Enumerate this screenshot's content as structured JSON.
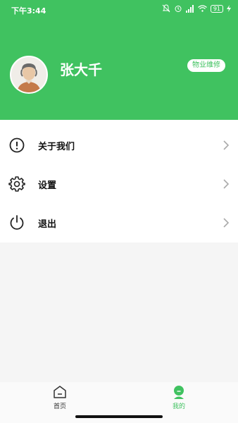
{
  "status_bar": {
    "time": "下午3:44",
    "battery": "91",
    "icons": [
      "mute-icon",
      "alarm-icon",
      "signal-icon",
      "wifi-icon",
      "battery-icon",
      "charging-icon"
    ]
  },
  "profile": {
    "name": "张大千",
    "role_badge": "物业维修"
  },
  "menu": {
    "items": [
      {
        "label": "关于我们",
        "icon": "info-icon"
      },
      {
        "label": "设置",
        "icon": "gear-icon"
      },
      {
        "label": "退出",
        "icon": "power-icon"
      }
    ]
  },
  "tabbar": {
    "tabs": [
      {
        "label": "首页",
        "icon": "home-icon",
        "active": false
      },
      {
        "label": "我的",
        "icon": "profile-icon",
        "active": true
      }
    ]
  },
  "colors": {
    "accent": "#40c260",
    "background": "#f5f5f5",
    "inactive_tab": "#333333"
  }
}
